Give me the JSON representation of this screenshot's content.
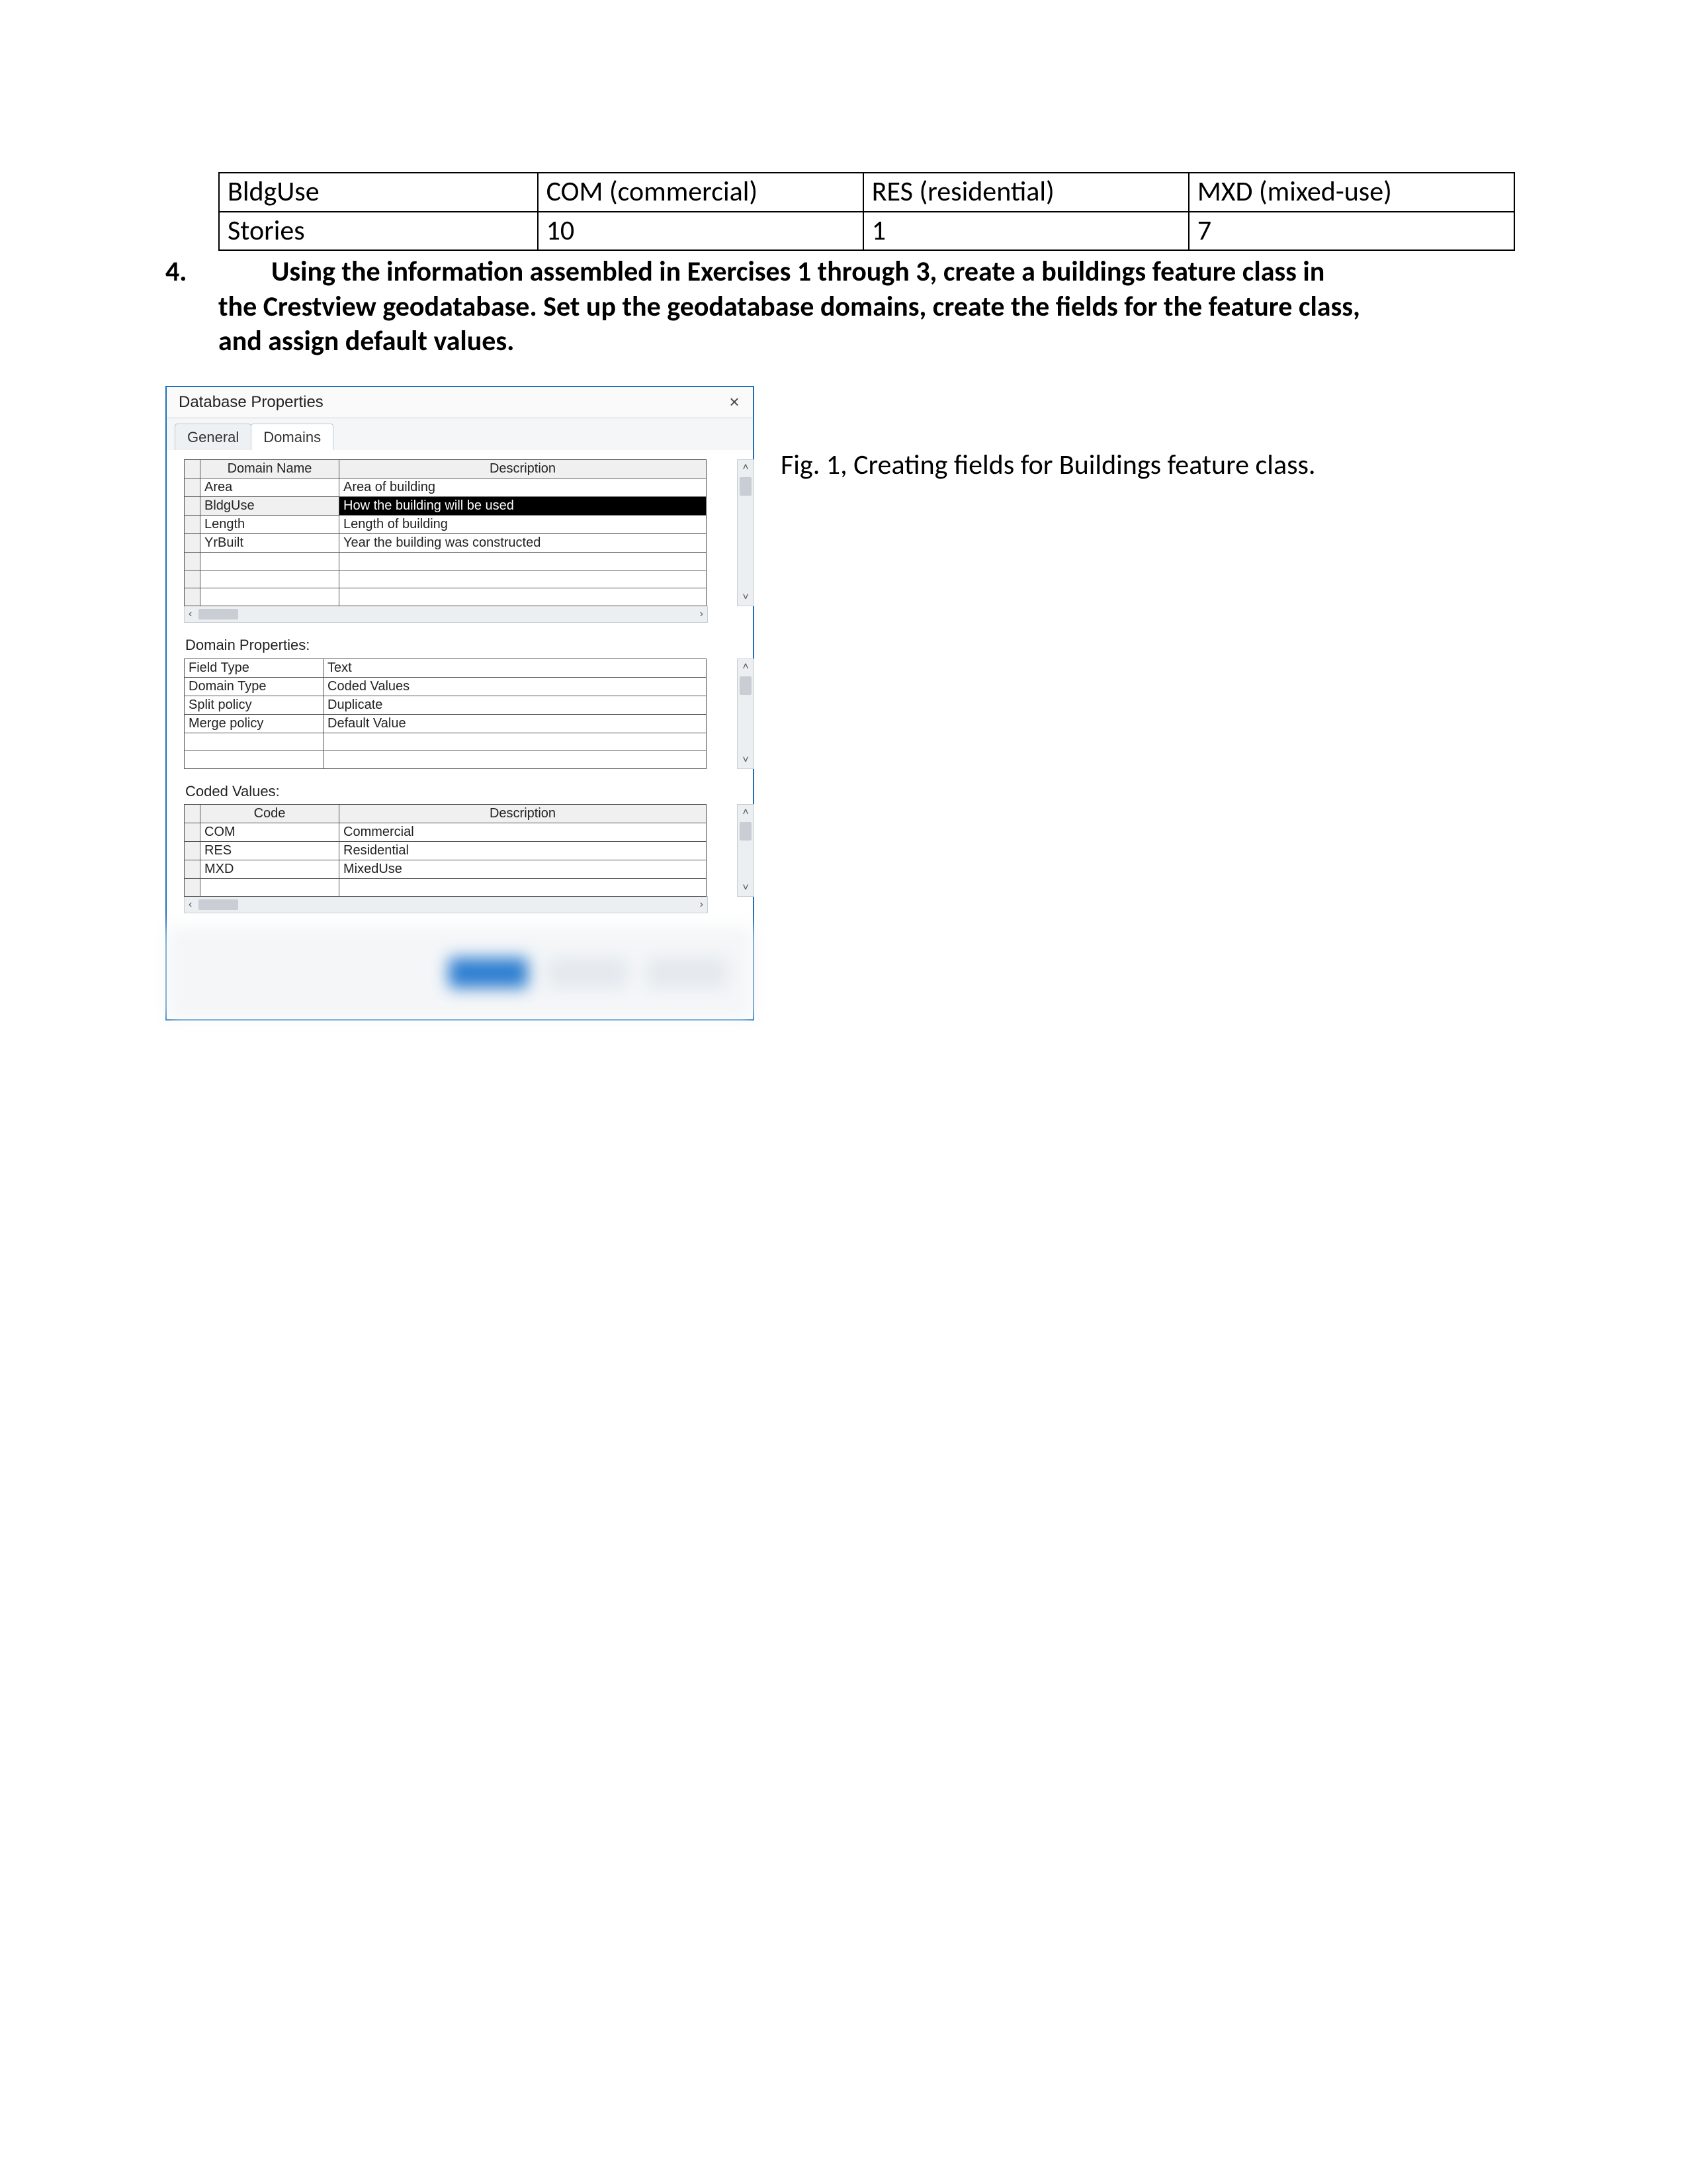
{
  "outer_table": {
    "rows": [
      {
        "c1": "BldgUse",
        "c2": "COM (commercial)",
        "c3": "RES (residential)",
        "c4": "MXD (mixed-use)"
      },
      {
        "c1": "Stories",
        "c2": "10",
        "c3": "1",
        "c4": "7"
      }
    ]
  },
  "question": {
    "number": "4.",
    "text_line1": "Using the information assembled in Exercises 1 through 3, create a buildings feature class in",
    "text_line2": "the Crestview geodatabase.  Set up the geodatabase domains, create the fields for the feature class,",
    "text_line3": "and assign default values."
  },
  "dialog": {
    "title": "Database Properties",
    "close_glyph": "×",
    "tabs": {
      "general": "General",
      "domains": "Domains"
    },
    "domain_grid": {
      "headers": {
        "name": "Domain Name",
        "desc": "Description"
      },
      "rows": [
        {
          "name": "Area",
          "desc": "Area of building",
          "selected": false
        },
        {
          "name": "BldgUse",
          "desc": "How the building will be used",
          "selected": true
        },
        {
          "name": "Length",
          "desc": "Length of building",
          "selected": false
        },
        {
          "name": "YrBuilt",
          "desc": "Year the building was constructed",
          "selected": false
        }
      ]
    },
    "domain_properties": {
      "label": "Domain Properties:",
      "rows": [
        {
          "k": "Field Type",
          "v": "Text"
        },
        {
          "k": "Domain Type",
          "v": "Coded Values"
        },
        {
          "k": "Split policy",
          "v": "Duplicate"
        },
        {
          "k": "Merge policy",
          "v": "Default Value"
        }
      ]
    },
    "coded_values": {
      "label": "Coded Values:",
      "headers": {
        "code": "Code",
        "desc": "Description"
      },
      "rows": [
        {
          "code": "COM",
          "desc": "Commercial"
        },
        {
          "code": "RES",
          "desc": "Residential"
        },
        {
          "code": "MXD",
          "desc": "MixedUse"
        }
      ]
    },
    "scroll": {
      "up": "˄",
      "down": "˅",
      "left": "‹",
      "right": "›"
    }
  },
  "caption": "Fig. 1, Creating fields for Buildings feature class."
}
